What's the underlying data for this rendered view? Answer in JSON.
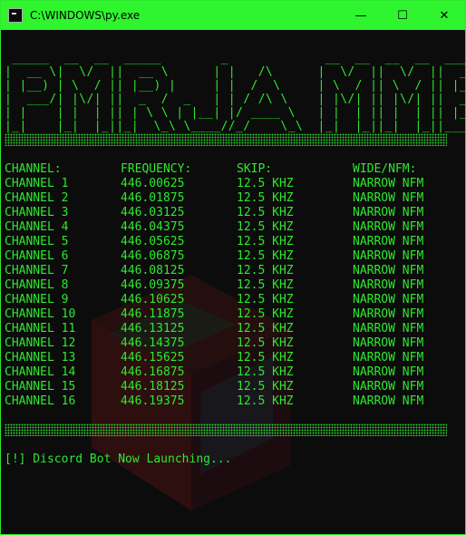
{
  "window": {
    "title": "C:\\WINDOWS\\py.exe",
    "accent_color": "#2ef52e",
    "text_color": "#2ee82e",
    "controls": {
      "minimize": "—",
      "maximize": "☐",
      "close": "✕"
    }
  },
  "console": {
    "banner_ascii": " _____  __  __  _____        _             __  __  __  __  ______  _____\n|  __ \\|  \\/  ||  __ \\      | |   /\\      |  \\/  ||  \\/  ||  ____||  __ \\\n| |__) | \\  / || |__) |     | |  /  \\     | \\  / || \\  / || |__   | |__) |\n|  ___/| |\\/| ||  _  /  _   | | / /\\ \\    | |\\/| || |\\/| ||  __|  |  _  /\n| |    | |  | || | \\ \\ | |__| |/ ____ \\   | |  | || |  | || |____ | | \\ \\\n|_|    |_|  |_||_|  \\_\\ \\____//_/    \\_\\  |_|  |_||_|  |_||______||_|  \\_\\",
    "headers": [
      "CHANNEL:",
      "FREQUENCY:",
      "SKIP:",
      "WIDE/NFM:"
    ],
    "rows": [
      [
        "CHANNEL 1",
        "446.00625",
        "12.5 KHZ",
        "NARROW NFM"
      ],
      [
        "CHANNEL 2",
        "446.01875",
        "12.5 KHZ",
        "NARROW NFM"
      ],
      [
        "CHANNEL 3",
        "446.03125",
        "12.5 KHZ",
        "NARROW NFM"
      ],
      [
        "CHANNEL 4",
        "446.04375",
        "12.5 KHZ",
        "NARROW NFM"
      ],
      [
        "CHANNEL 5",
        "446.05625",
        "12.5 KHZ",
        "NARROW NFM"
      ],
      [
        "CHANNEL 6",
        "446.06875",
        "12.5 KHZ",
        "NARROW NFM"
      ],
      [
        "CHANNEL 7",
        "446.08125",
        "12.5 KHZ",
        "NARROW NFM"
      ],
      [
        "CHANNEL 8",
        "446.09375",
        "12.5 KHZ",
        "NARROW NFM"
      ],
      [
        "CHANNEL 9",
        "446.10625",
        "12.5 KHZ",
        "NARROW NFM"
      ],
      [
        "CHANNEL 10",
        "446.11875",
        "12.5 KHZ",
        "NARROW NFM"
      ],
      [
        "CHANNEL 11",
        "446.13125",
        "12.5 KHZ",
        "NARROW NFM"
      ],
      [
        "CHANNEL 12",
        "446.14375",
        "12.5 KHZ",
        "NARROW NFM"
      ],
      [
        "CHANNEL 13",
        "446.15625",
        "12.5 KHZ",
        "NARROW NFM"
      ],
      [
        "CHANNEL 14",
        "446.16875",
        "12.5 KHZ",
        "NARROW NFM"
      ],
      [
        "CHANNEL 15",
        "446.18125",
        "12.5 KHZ",
        "NARROW NFM"
      ],
      [
        "CHANNEL 16",
        "446.19375",
        "12.5 KHZ",
        "NARROW NFM"
      ]
    ],
    "status_line": "[!] Discord Bot Now Launching..."
  }
}
